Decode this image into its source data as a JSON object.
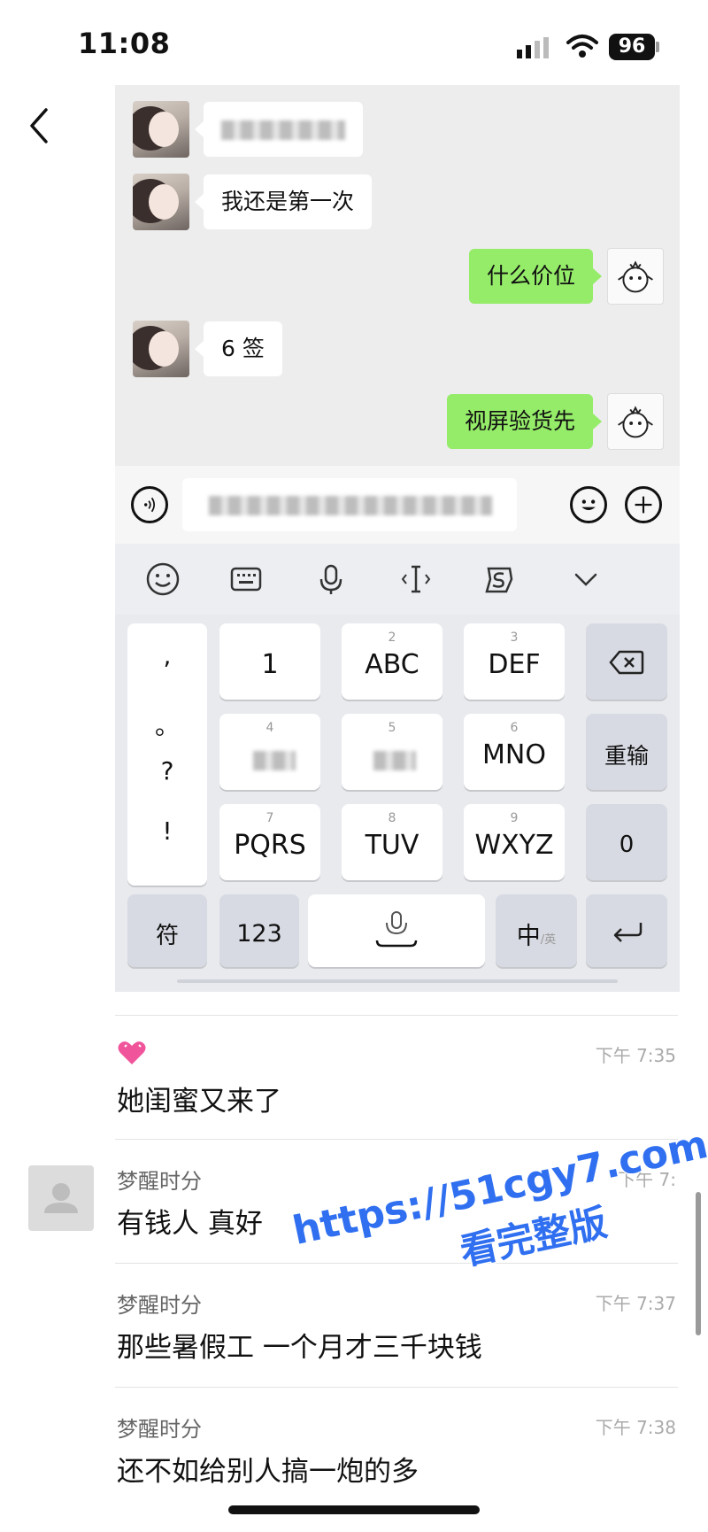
{
  "status_bar": {
    "time": "11:08",
    "battery": "96"
  },
  "chat": {
    "messages": [
      {
        "side": "left",
        "text": "",
        "blurred": true
      },
      {
        "side": "left",
        "text": "我还是第一次"
      },
      {
        "side": "right",
        "text": "什么价位"
      },
      {
        "side": "left",
        "text": "6 签"
      },
      {
        "side": "right",
        "text": "视屏验货先"
      }
    ]
  },
  "keyboard": {
    "punct": [
      ",",
      "。",
      "?",
      "!"
    ],
    "row1": [
      {
        "num": "",
        "label": "1"
      },
      {
        "num": "2",
        "label": "ABC"
      },
      {
        "num": "3",
        "label": "DEF"
      }
    ],
    "row2": [
      {
        "num": "4",
        "label": ""
      },
      {
        "num": "5",
        "label": ""
      },
      {
        "num": "6",
        "label": "MNO"
      }
    ],
    "row3": [
      {
        "num": "7",
        "label": "PQRS"
      },
      {
        "num": "8",
        "label": "TUV"
      },
      {
        "num": "9",
        "label": "WXYZ"
      }
    ],
    "reenter": "重输",
    "zero": "0",
    "symbols": "符",
    "numbers": "123",
    "lang_main": "中",
    "lang_sub": "/英"
  },
  "comments": [
    {
      "user": "",
      "text": "她闺蜜又来了",
      "time": "下午 7:35"
    },
    {
      "user": "梦醒时分",
      "text": "有钱人  真好",
      "time": "下午 7:"
    },
    {
      "user": "梦醒时分",
      "text": "那些暑假工  一个月才三千块钱",
      "time": "下午 7:37"
    },
    {
      "user": "梦醒时分",
      "text": "还不如给别人搞一炮的多",
      "time": "下午 7:38"
    }
  ],
  "watermark": {
    "line1": "https://51cgy7.com",
    "line2": "看完整版"
  },
  "colors": {
    "bubble_green": "#95ec69",
    "watermark_blue": "#2f6ff0",
    "chat_bg": "#ededed"
  }
}
